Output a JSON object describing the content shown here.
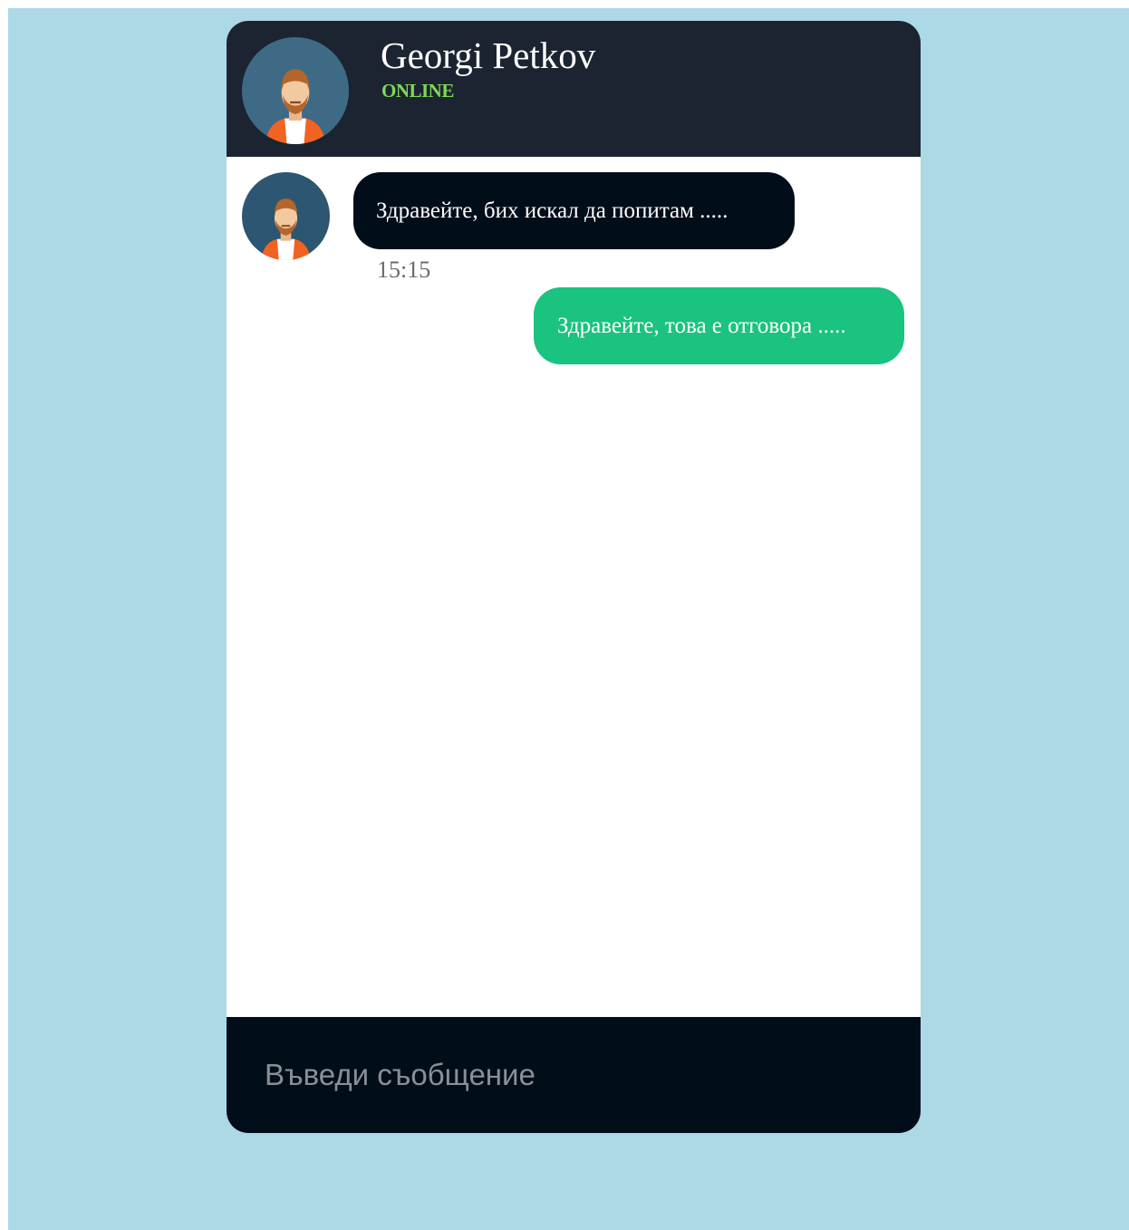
{
  "header": {
    "name": "Georgi Petkov",
    "status": "ONLINE",
    "avatar_icon": "male-avatar-icon"
  },
  "messages": [
    {
      "direction": "incoming",
      "text": "Здравейте, бих искал да попитам .....",
      "time": "15:15",
      "avatar_icon": "male-avatar-icon"
    },
    {
      "direction": "outgoing",
      "text": "Здравейте, това е отговора ....."
    }
  ],
  "composer": {
    "placeholder": "Въведи съобщение",
    "value": ""
  },
  "colors": {
    "page_background": "#add8e6",
    "header_background": "#1c2431",
    "status_online": "#7ed957",
    "incoming_bubble": "#020d1a",
    "outgoing_bubble": "#1ac37f",
    "footer_background": "#020d1a"
  }
}
